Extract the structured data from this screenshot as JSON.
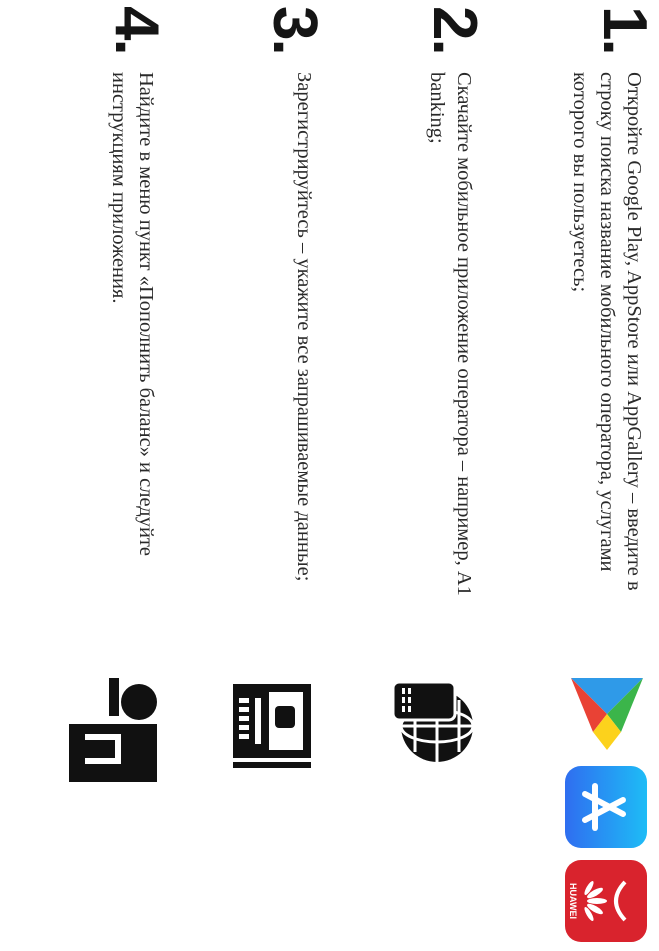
{
  "steps": [
    {
      "number": "1.",
      "text": "Откройте Google Play, AppStore или AppGallery – введите в строку поиска название мобильного оператора, услугами которого вы пользуетесь;",
      "icons": [
        "google-play-icon",
        "app-store-icon",
        "huawei-appgallery-icon"
      ]
    },
    {
      "number": "2.",
      "text": "Скачайте мобильное приложение оператора – например, A1 banking;",
      "icons": [
        "phone-globe-icon"
      ]
    },
    {
      "number": "3.",
      "text": "Зарегистрируйтесь – укажите все запрашиваемые данные;",
      "icons": [
        "registration-form-icon"
      ]
    },
    {
      "number": "4.",
      "text": "Найдите в меню пункт «Пополнить баланс» и следуйте инструкциям приложения.",
      "icons": [
        "top-up-balance-icon"
      ]
    }
  ],
  "brand": {
    "huawei_label": "HUAWEI"
  },
  "colors": {
    "play_green": "#3bb54a",
    "play_blue": "#2f9ae8",
    "play_yellow": "#fcd21c",
    "play_red": "#e94235",
    "appstore_blue": "#2f8df4",
    "huawei_red": "#d9232d"
  }
}
